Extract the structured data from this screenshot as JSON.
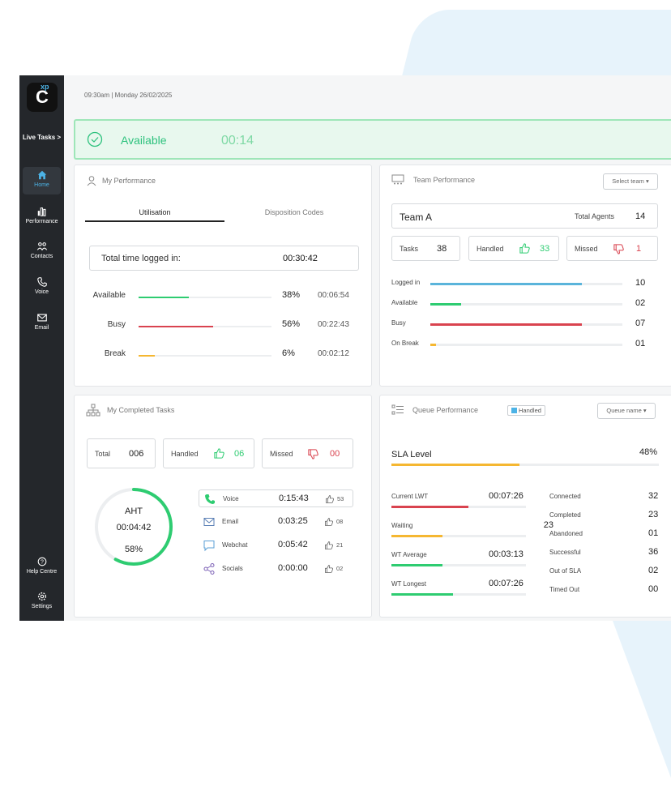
{
  "datetime": "09:30am | Monday 26/02/2025",
  "sidebar": {
    "logo_letter": "C",
    "logo_sup": "xp",
    "live_tasks": "Live Tasks >",
    "items": [
      {
        "label": "Home",
        "icon": "home-icon",
        "active": true
      },
      {
        "label": "Performance",
        "icon": "bar-chart-icon"
      },
      {
        "label": "Contacts",
        "icon": "contacts-icon"
      },
      {
        "label": "Voice",
        "icon": "phone-icon"
      },
      {
        "label": "Email",
        "icon": "mail-icon"
      }
    ],
    "help": "Help Centre",
    "settings": "Settings"
  },
  "status": {
    "label": "Available",
    "timer": "00:14",
    "color": "#2ec27e"
  },
  "my_performance": {
    "title": "My Performance",
    "tabs": [
      "Utilisation",
      "Disposition Codes"
    ],
    "total_label": "Total time logged in:",
    "total_value": "00:30:42",
    "rows": [
      {
        "label": "Available",
        "pct": "38%",
        "fraction": 0.38,
        "time": "00:06:54",
        "color": "#2ecc71"
      },
      {
        "label": "Busy",
        "pct": "56%",
        "fraction": 0.56,
        "time": "00:22:43",
        "color": "#d9434f"
      },
      {
        "label": "Break",
        "pct": "6%",
        "fraction": 0.12,
        "time": "00:02:12",
        "color": "#f5b731"
      }
    ]
  },
  "team_performance": {
    "title": "Team Performance",
    "select_team": "Select team",
    "team_name": "Team A",
    "total_agents_label": "Total Agents",
    "total_agents": "14",
    "tasks_label": "Tasks",
    "tasks": "38",
    "handled_label": "Handled",
    "handled": "33",
    "missed_label": "Missed",
    "missed": "1",
    "rows": [
      {
        "label": "Logged in",
        "value": "10",
        "fraction": 0.79,
        "color": "#5ab4db"
      },
      {
        "label": "Available",
        "value": "02",
        "fraction": 0.16,
        "color": "#2ecc71"
      },
      {
        "label": "Busy",
        "value": "07",
        "fraction": 0.79,
        "color": "#d9434f"
      },
      {
        "label": "On Break",
        "value": "01",
        "fraction": 0.03,
        "color": "#f5b731"
      }
    ]
  },
  "completed_tasks": {
    "title": "My Completed Tasks",
    "total_label": "Total",
    "total": "006",
    "handled_label": "Handled",
    "handled": "06",
    "missed_label": "Missed",
    "missed": "00",
    "aht_label": "AHT",
    "aht_time": "00:04:42",
    "aht_pct": "58%",
    "aht_fraction": 0.58,
    "channels": [
      {
        "label": "Voice",
        "time": "0:15:43",
        "count": "53",
        "icon": "phone-icon"
      },
      {
        "label": "Email",
        "time": "0:03:25",
        "count": "08",
        "icon": "mail-icon"
      },
      {
        "label": "Webchat",
        "time": "0:05:42",
        "count": "21",
        "icon": "chat-icon"
      },
      {
        "label": "Socials",
        "time": "0:00:00",
        "count": "02",
        "icon": "share-icon"
      }
    ]
  },
  "queue_performance": {
    "title": "Queue Performance",
    "handled_chip": "Handled",
    "queue_name": "Queue name",
    "sla_label": "SLA Level",
    "sla_pct": "48%",
    "sla_fraction": 0.48,
    "left": [
      {
        "label": "Current LWT",
        "value": "00:07:26",
        "fraction": 0.57,
        "color": "#d9434f"
      },
      {
        "label": "Waiting",
        "value": "23",
        "fraction": 0.38,
        "color": "#f5b731"
      },
      {
        "label": "WT Average",
        "value": "00:03:13",
        "fraction": 0.38,
        "color": "#2ecc71"
      },
      {
        "label": "WT Longest",
        "value": "00:07:26",
        "fraction": 0.46,
        "color": "#2ecc71"
      }
    ],
    "right": [
      {
        "label": "Connected",
        "value": "32"
      },
      {
        "label": "Completed",
        "value": "23"
      },
      {
        "label": "Abandoned",
        "value": "01"
      },
      {
        "label": "Successful",
        "value": "36"
      },
      {
        "label": "Out of SLA",
        "value": "02"
      },
      {
        "label": "Timed Out",
        "value": "00"
      }
    ]
  }
}
